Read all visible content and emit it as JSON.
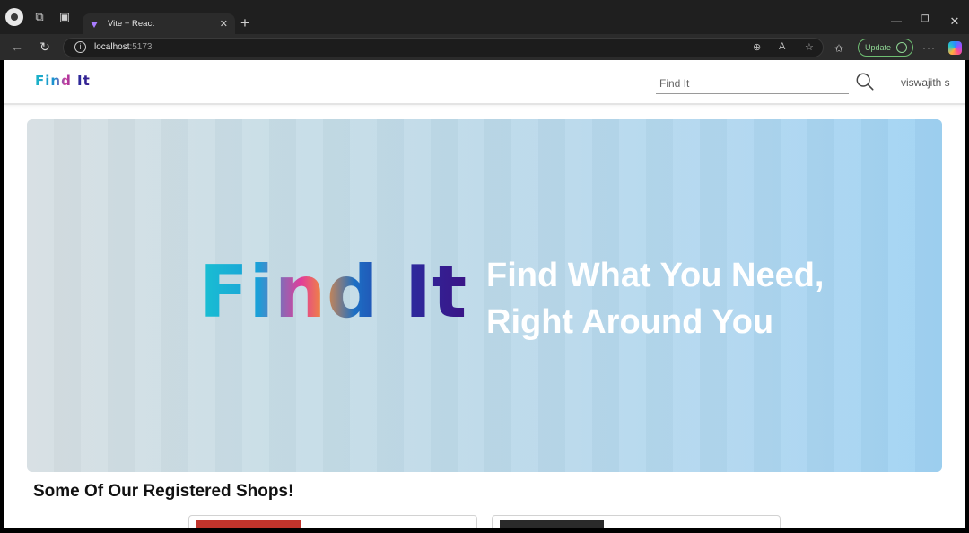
{
  "browser": {
    "tab_title": "Vite + React",
    "tab_close": "✕",
    "new_tab": "+",
    "url_host": "localhost",
    "url_port": ":5173",
    "update_label": "Update",
    "window_min": "—",
    "window_max": "❐",
    "window_close": "✕",
    "more": "···"
  },
  "header": {
    "logo": "Find It",
    "search_placeholder": "Find It",
    "username": "viswajith s"
  },
  "hero": {
    "logo_text": "Find It",
    "tagline": "Find What You Need, Right Around You"
  },
  "shops": {
    "section_title": "Some Of Our Registered Shops!"
  },
  "colors": {
    "hero_left": "#d6dee2",
    "hero_right": "#9fd2f3",
    "update_accent": "#6fbf73"
  }
}
